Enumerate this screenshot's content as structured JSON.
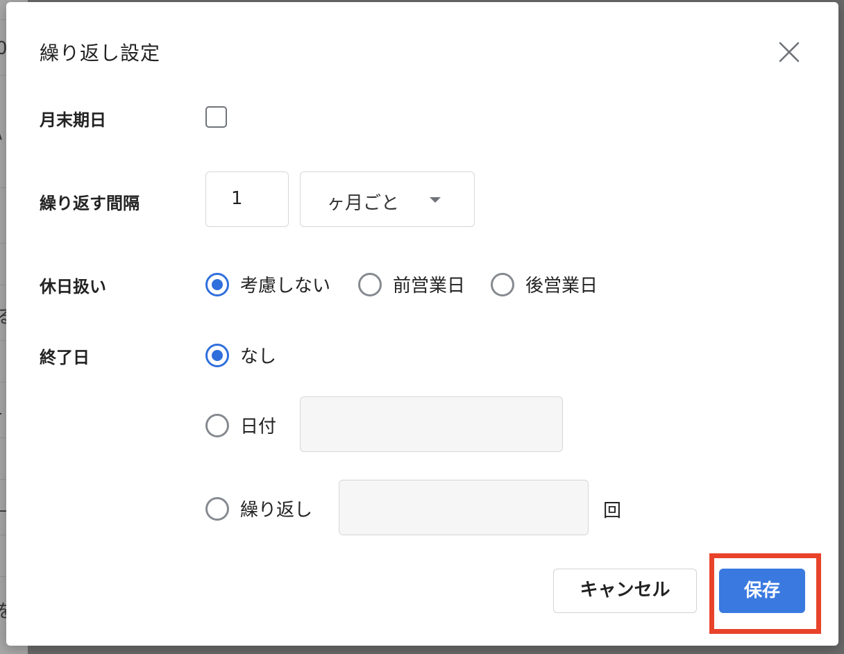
{
  "background": {
    "glyphs": [
      "0",
      "\\",
      "る",
      "-",
      "—",
      "を"
    ]
  },
  "dialog": {
    "title": "繰り返し設定",
    "close_icon": "close-icon"
  },
  "fields": {
    "month_end_label": "月末期日",
    "month_end_checked": false,
    "interval_label": "繰り返す間隔",
    "interval_value": "1",
    "interval_unit": "ヶ月ごと",
    "holiday_label": "休日扱い",
    "holiday_options": [
      "考慮しない",
      "前営業日",
      "後営業日"
    ],
    "holiday_selected": "考慮しない",
    "end_label": "終了日",
    "end_options": {
      "none": "なし",
      "date": "日付",
      "repeat": "繰り返し"
    },
    "end_selected": "なし",
    "date_value": "",
    "repeat_count_value": "",
    "repeat_unit": "回"
  },
  "buttons": {
    "cancel": "キャンセル",
    "save": "保存"
  },
  "colors": {
    "accent": "#3a7ae0",
    "highlight": "#e8432a"
  }
}
